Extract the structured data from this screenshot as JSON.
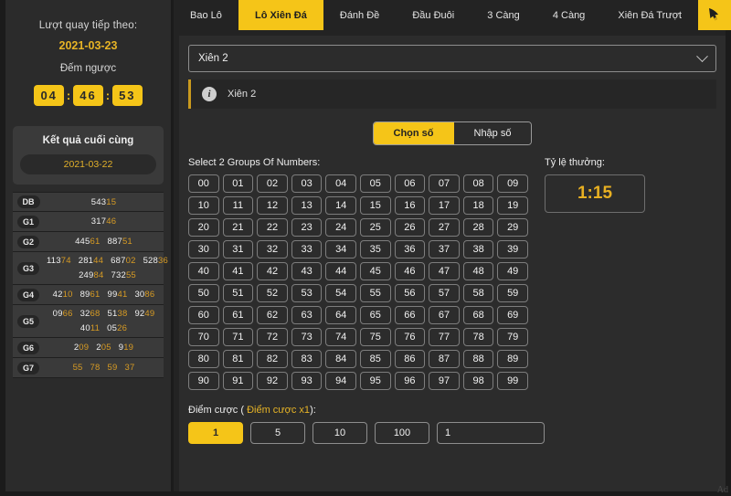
{
  "sidebar": {
    "next_draw_label": "Lượt quay tiếp theo:",
    "next_draw_date": "2021-03-23",
    "countdown_label": "Đếm ngược",
    "countdown": {
      "hours": "04",
      "minutes": "46",
      "seconds": "53",
      "separator": ":"
    },
    "final_result_title": "Kết quả cuối cùng",
    "final_result_date": "2021-03-22",
    "results": [
      {
        "tag": "DB",
        "lines": [
          [
            {
              "pre": "543",
              "suf": "15"
            }
          ]
        ]
      },
      {
        "tag": "G1",
        "lines": [
          [
            {
              "pre": "317",
              "suf": "46"
            }
          ]
        ]
      },
      {
        "tag": "G2",
        "lines": [
          [
            {
              "pre": "445",
              "suf": "61"
            },
            {
              "pre": "887",
              "suf": "51"
            }
          ]
        ]
      },
      {
        "tag": "G3",
        "lines": [
          [
            {
              "pre": "113",
              "suf": "74"
            },
            {
              "pre": "281",
              "suf": "44"
            },
            {
              "pre": "687",
              "suf": "02"
            },
            {
              "pre": "528",
              "suf": "36"
            }
          ],
          [
            {
              "pre": "249",
              "suf": "84"
            },
            {
              "pre": "732",
              "suf": "55"
            }
          ]
        ]
      },
      {
        "tag": "G4",
        "lines": [
          [
            {
              "pre": "42",
              "suf": "10"
            },
            {
              "pre": "89",
              "suf": "61"
            },
            {
              "pre": "99",
              "suf": "41"
            },
            {
              "pre": "30",
              "suf": "86"
            }
          ]
        ]
      },
      {
        "tag": "G5",
        "lines": [
          [
            {
              "pre": "09",
              "suf": "66"
            },
            {
              "pre": "32",
              "suf": "68"
            },
            {
              "pre": "51",
              "suf": "38"
            },
            {
              "pre": "92",
              "suf": "49"
            }
          ],
          [
            {
              "pre": "40",
              "suf": "11"
            },
            {
              "pre": "05",
              "suf": "26"
            }
          ]
        ]
      },
      {
        "tag": "G6",
        "lines": [
          [
            {
              "pre": "2",
              "suf": "09"
            },
            {
              "pre": "2",
              "suf": "05"
            },
            {
              "pre": "9",
              "suf": "19"
            }
          ]
        ]
      },
      {
        "tag": "G7",
        "lines": [
          [
            {
              "pre": "",
              "suf": "55"
            },
            {
              "pre": "",
              "suf": "78"
            },
            {
              "pre": "",
              "suf": "59"
            },
            {
              "pre": "",
              "suf": "37"
            }
          ]
        ]
      }
    ]
  },
  "tabs": [
    {
      "label": "Bao Lô",
      "active": false
    },
    {
      "label": "Lô Xiên Đá",
      "active": true
    },
    {
      "label": "Đánh Đề",
      "active": false
    },
    {
      "label": "Đầu Đuôi",
      "active": false
    },
    {
      "label": "3 Càng",
      "active": false
    },
    {
      "label": "4 Càng",
      "active": false
    },
    {
      "label": "Xiên Đá Trượt",
      "active": false
    }
  ],
  "cursor_button_icon": "hand-cursor-icon",
  "main": {
    "select_value": "Xiên 2",
    "info_icon": "info-circle-icon",
    "info_text": "Xiên 2",
    "mode_toggle": [
      {
        "label": "Chọn số",
        "active": true
      },
      {
        "label": "Nhập số",
        "active": false
      }
    ],
    "grid_label": "Select 2 Groups Of Numbers:",
    "numbers": [
      "00",
      "01",
      "02",
      "03",
      "04",
      "05",
      "06",
      "07",
      "08",
      "09",
      "10",
      "11",
      "12",
      "13",
      "14",
      "15",
      "16",
      "17",
      "18",
      "19",
      "20",
      "21",
      "22",
      "23",
      "24",
      "25",
      "26",
      "27",
      "28",
      "29",
      "30",
      "31",
      "32",
      "33",
      "34",
      "35",
      "36",
      "37",
      "38",
      "39",
      "40",
      "41",
      "42",
      "43",
      "44",
      "45",
      "46",
      "47",
      "48",
      "49",
      "50",
      "51",
      "52",
      "53",
      "54",
      "55",
      "56",
      "57",
      "58",
      "59",
      "60",
      "61",
      "62",
      "63",
      "64",
      "65",
      "66",
      "67",
      "68",
      "69",
      "70",
      "71",
      "72",
      "73",
      "74",
      "75",
      "76",
      "77",
      "78",
      "79",
      "80",
      "81",
      "82",
      "83",
      "84",
      "85",
      "86",
      "87",
      "88",
      "89",
      "90",
      "91",
      "92",
      "93",
      "94",
      "95",
      "96",
      "97",
      "98",
      "99"
    ],
    "rate_label": "Tỷ lệ thưởng:",
    "rate_value": "1:15",
    "bet_label_prefix": "Điểm cược ( ",
    "bet_label_highlight": "Điểm cược x1",
    "bet_label_suffix": "):",
    "bet_options": [
      {
        "label": "1",
        "active": true
      },
      {
        "label": "5",
        "active": false
      },
      {
        "label": "10",
        "active": false
      },
      {
        "label": "100",
        "active": false
      }
    ],
    "bet_input_value": "1"
  },
  "watermark": "Ad",
  "colors": {
    "accent": "#f5c518",
    "accent_text": "#e7b426",
    "panel_bg": "#2c2c2c",
    "page_bg": "#232323",
    "sidebar_bg": "#2b2b2b",
    "result_suffix": "#d79b24"
  }
}
